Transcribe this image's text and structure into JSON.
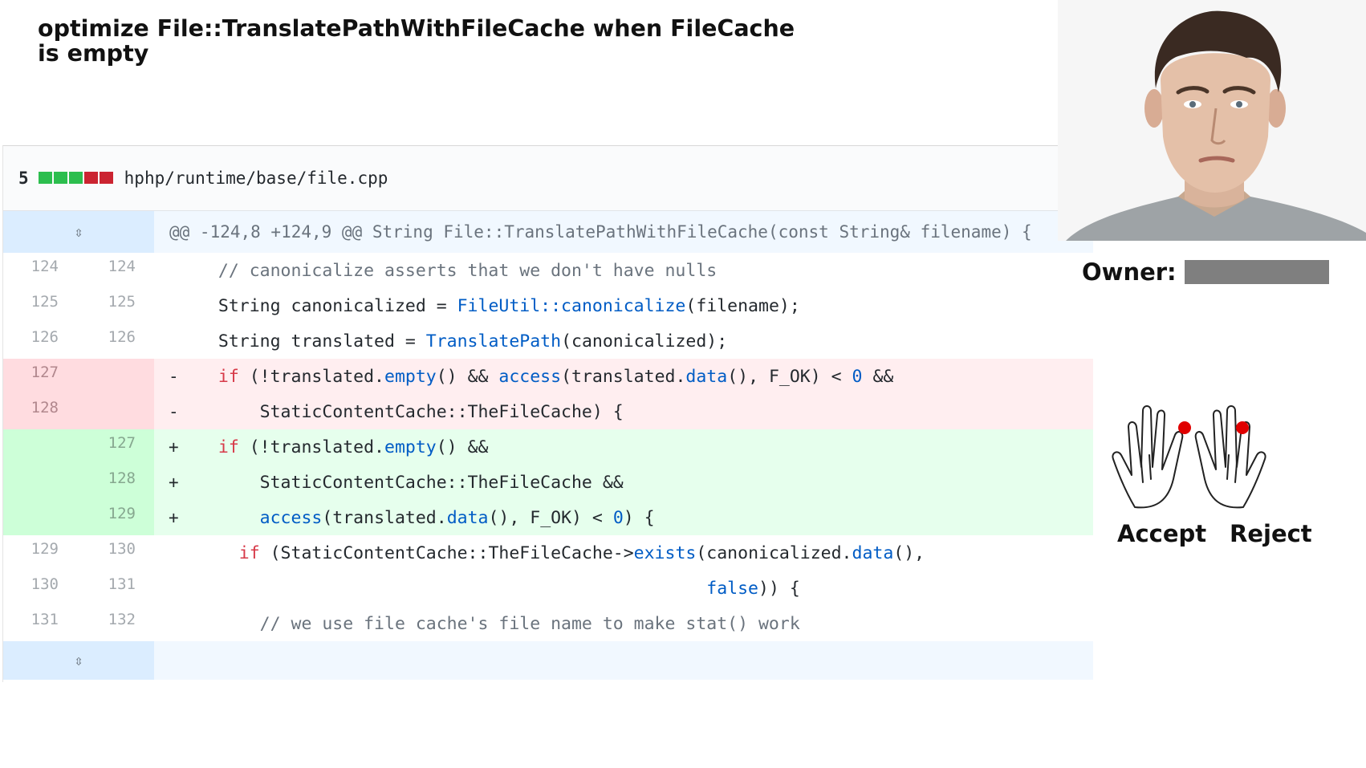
{
  "title": "optimize File::TranslatePathWithFileCache when FileCache is empty",
  "file": {
    "change_count": "5",
    "stat_blocks": [
      "#2cbe4e",
      "#2cbe4e",
      "#2cbe4e",
      "#cb2431",
      "#cb2431"
    ],
    "path": "hphp/runtime/base/file.cpp",
    "expand_icon": "unfold-icon"
  },
  "hunk": "@@ -124,8 +124,9 @@ String File::TranslatePathWithFileCache(const String& filename) {",
  "lines": [
    {
      "type": "ctx",
      "old": "124",
      "new": "124",
      "marker": "",
      "code": "  // canonicalize asserts that we don't have nulls"
    },
    {
      "type": "ctx",
      "old": "125",
      "new": "125",
      "marker": "",
      "code": "  String canonicalized = FileUtil::canonicalize(filename);"
    },
    {
      "type": "ctx",
      "old": "126",
      "new": "126",
      "marker": "",
      "code": "  String translated = TranslatePath(canonicalized);"
    },
    {
      "type": "del",
      "old": "127",
      "new": "",
      "marker": "-",
      "code": "  if (!translated.empty() && access(translated.data(), F_OK) < 0 &&"
    },
    {
      "type": "del",
      "old": "128",
      "new": "",
      "marker": "-",
      "code": "      StaticContentCache::TheFileCache) {"
    },
    {
      "type": "add",
      "old": "",
      "new": "127",
      "marker": "+",
      "code": "  if (!translated.empty() &&"
    },
    {
      "type": "add",
      "old": "",
      "new": "128",
      "marker": "+",
      "code": "      StaticContentCache::TheFileCache &&"
    },
    {
      "type": "add",
      "old": "",
      "new": "129",
      "marker": "+",
      "code": "      access(translated.data(), F_OK) < 0) {"
    },
    {
      "type": "ctx",
      "old": "129",
      "new": "130",
      "marker": "",
      "code": "    if (StaticContentCache::TheFileCache->exists(canonicalized.data(),"
    },
    {
      "type": "ctx",
      "old": "130",
      "new": "131",
      "marker": "",
      "code": "                                                 false)) {"
    },
    {
      "type": "ctx",
      "old": "131",
      "new": "132",
      "marker": "",
      "code": "      // we use file cache's file name to make stat() work"
    }
  ],
  "sidebar": {
    "owner_label": "Owner:",
    "accept_label": "Accept",
    "reject_label": "Reject",
    "marker_color": "#e00000"
  }
}
